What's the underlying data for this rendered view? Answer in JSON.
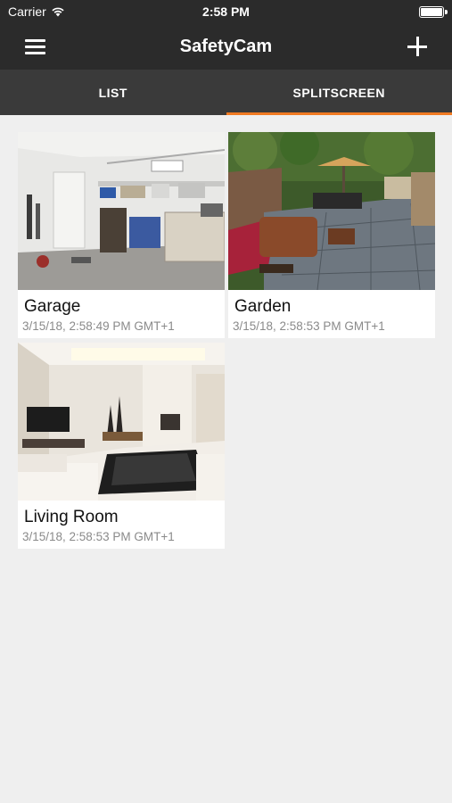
{
  "status": {
    "carrier": "Carrier",
    "time": "2:58 PM"
  },
  "nav": {
    "title": "SafetyCam"
  },
  "tabs": [
    {
      "label": "LIST",
      "active": false
    },
    {
      "label": "SPLITSCREEN",
      "active": true
    }
  ],
  "accent_color": "#f07a22",
  "cameras": [
    {
      "name": "Garage",
      "timestamp": "3/15/18, 2:58:49 PM GMT+1"
    },
    {
      "name": "Garden",
      "timestamp": "3/15/18, 2:58:53 PM GMT+1"
    },
    {
      "name": "Living Room",
      "timestamp": "3/15/18, 2:58:53 PM GMT+1"
    }
  ]
}
